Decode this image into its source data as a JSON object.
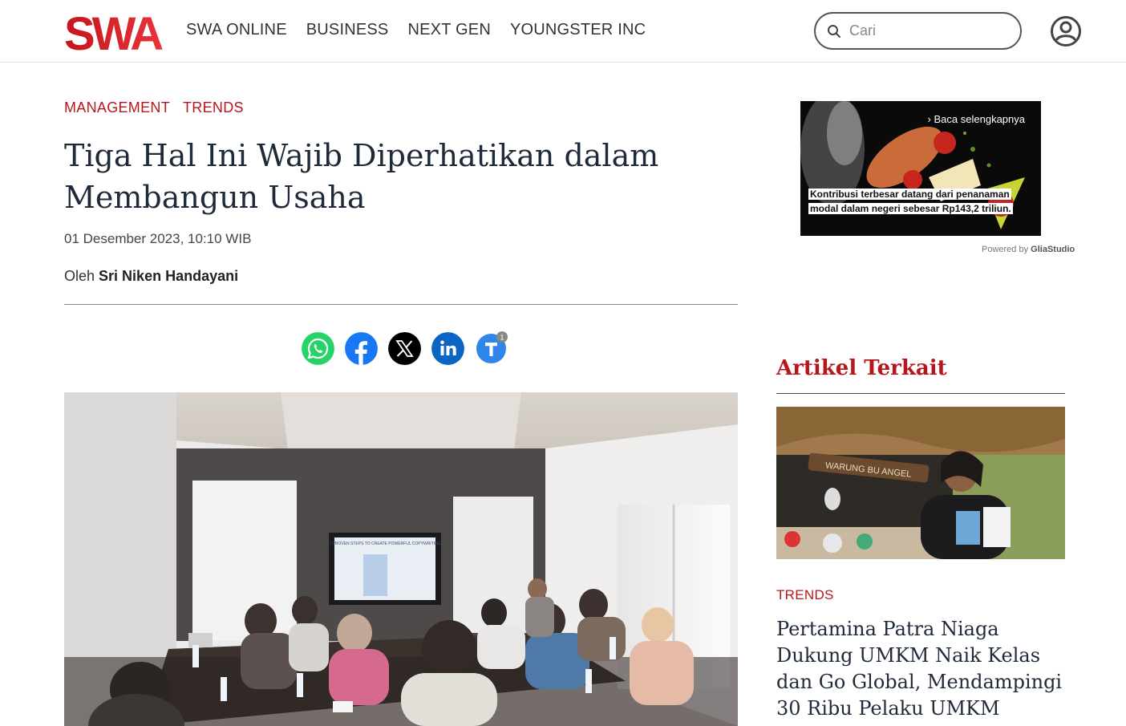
{
  "header": {
    "logo_text": "SWA",
    "nav": [
      "SWA ONLINE",
      "BUSINESS",
      "NEXT GEN",
      "YOUNGSTER INC"
    ],
    "search_placeholder": "Cari",
    "colors": {
      "brand_red": "#c4161c",
      "border": "#555555"
    }
  },
  "article": {
    "categories": [
      "MANAGEMENT",
      "TRENDS"
    ],
    "title": "Tiga Hal Ini Wajib Diperhatikan dalam Membangun Usaha",
    "date": "01 Desember 2023, 10:10 WIB",
    "author_prefix": "Oleh",
    "author_name": "Sri Niken Handayani",
    "share": [
      {
        "name": "whatsapp",
        "color": "#25d366"
      },
      {
        "name": "facebook",
        "color": "#1877f2"
      },
      {
        "name": "x",
        "color": "#000000"
      },
      {
        "name": "linkedin",
        "color": "#0a66c2"
      },
      {
        "name": "telegram",
        "color": "#2f86e8"
      }
    ],
    "share_badge": "1",
    "hero_screen_text": "7 PROVEN STEPS TO CREATE POWERFUL COPYWRITING"
  },
  "sidebar": {
    "ad": {
      "more_label": "Baca selengkapnya",
      "caption": "Kontribusi terbesar datang dari penanaman modal dalam negeri sebesar Rp143,2 triliun.",
      "powered_prefix": "Powered by",
      "powered_brand": "GliaStudio"
    },
    "related_heading": "Artikel Terkait",
    "related": {
      "sign_text": "WARUNG BU ANGEL",
      "category": "TRENDS",
      "title": "Pertamina Patra Niaga Dukung UMKM Naik Kelas dan Go Global, Mendampingi 30 Ribu Pelaku UMKM"
    }
  }
}
